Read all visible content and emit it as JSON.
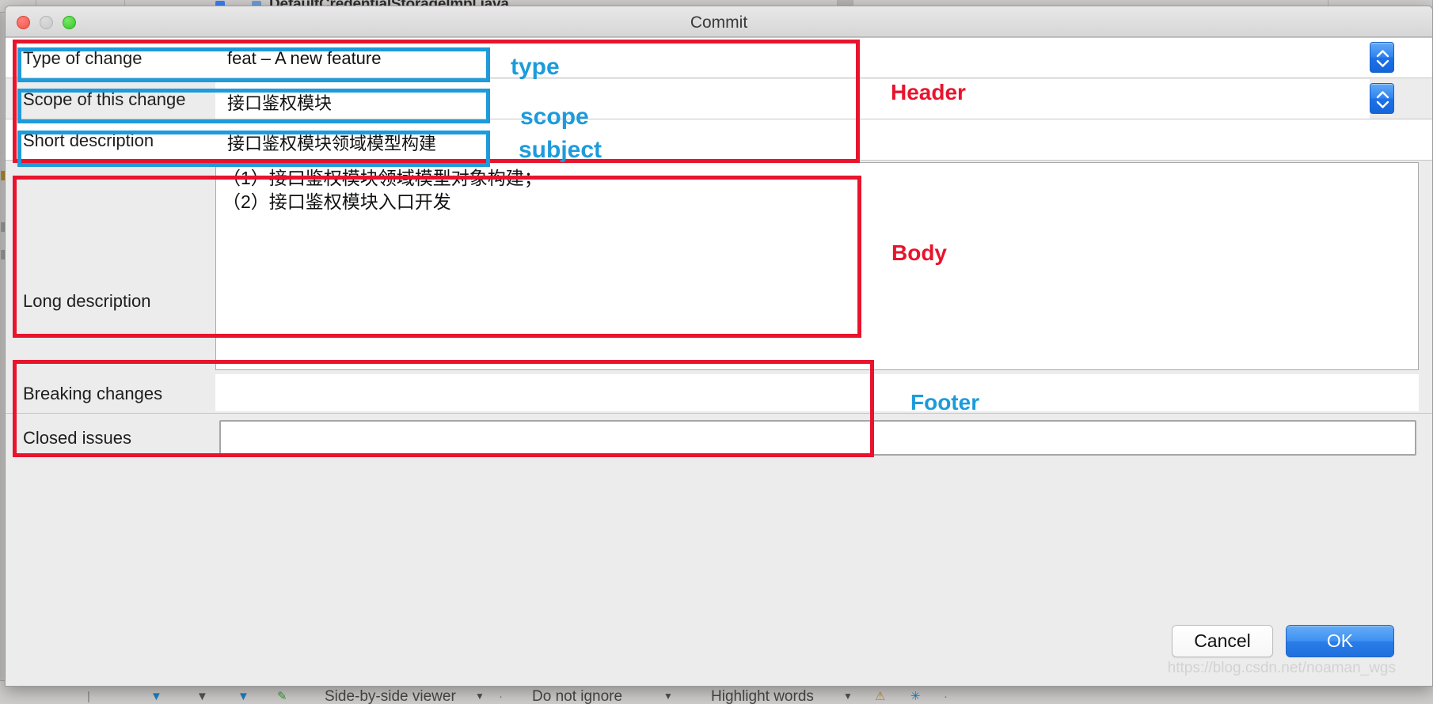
{
  "window": {
    "title": "Commit",
    "traffic_lights": [
      "close",
      "minimize",
      "maximize"
    ]
  },
  "ide_background": {
    "tab_title": "DefaultCredentialStorageImpl.java",
    "bottom_items": [
      "Side-by-side viewer",
      "Do not ignore",
      "Highlight words"
    ]
  },
  "form": {
    "rows": [
      {
        "label": "Type of change",
        "value": "feat – A new feature",
        "control": "combobox"
      },
      {
        "label": "Scope of this change",
        "value": "接口鉴权模块",
        "control": "combobox"
      },
      {
        "label": "Short description",
        "value": "接口鉴权模块领域模型构建",
        "control": "textfield"
      }
    ],
    "long_description": {
      "label": "Long description",
      "value": "（1）接口鉴权模块领域模型对象构建；\n（2）接口鉴权模块入口开发"
    },
    "breaking_changes": {
      "label": "Breaking changes",
      "value": ""
    },
    "closed_issues": {
      "label": "Closed issues",
      "value": ""
    }
  },
  "buttons": {
    "cancel": "Cancel",
    "ok": "OK"
  },
  "watermark": "https://blog.csdn.net/noaman_wgs",
  "annotations": {
    "type": "type",
    "scope": "scope",
    "subject": "subject",
    "header": "Header",
    "body": "Body",
    "footer": "Footer"
  },
  "colors": {
    "annotation_red": "#e8142d",
    "annotation_blue": "#1d9bdb",
    "accent_blue": "#2a7ee9",
    "dialog_bg": "#ececec"
  }
}
